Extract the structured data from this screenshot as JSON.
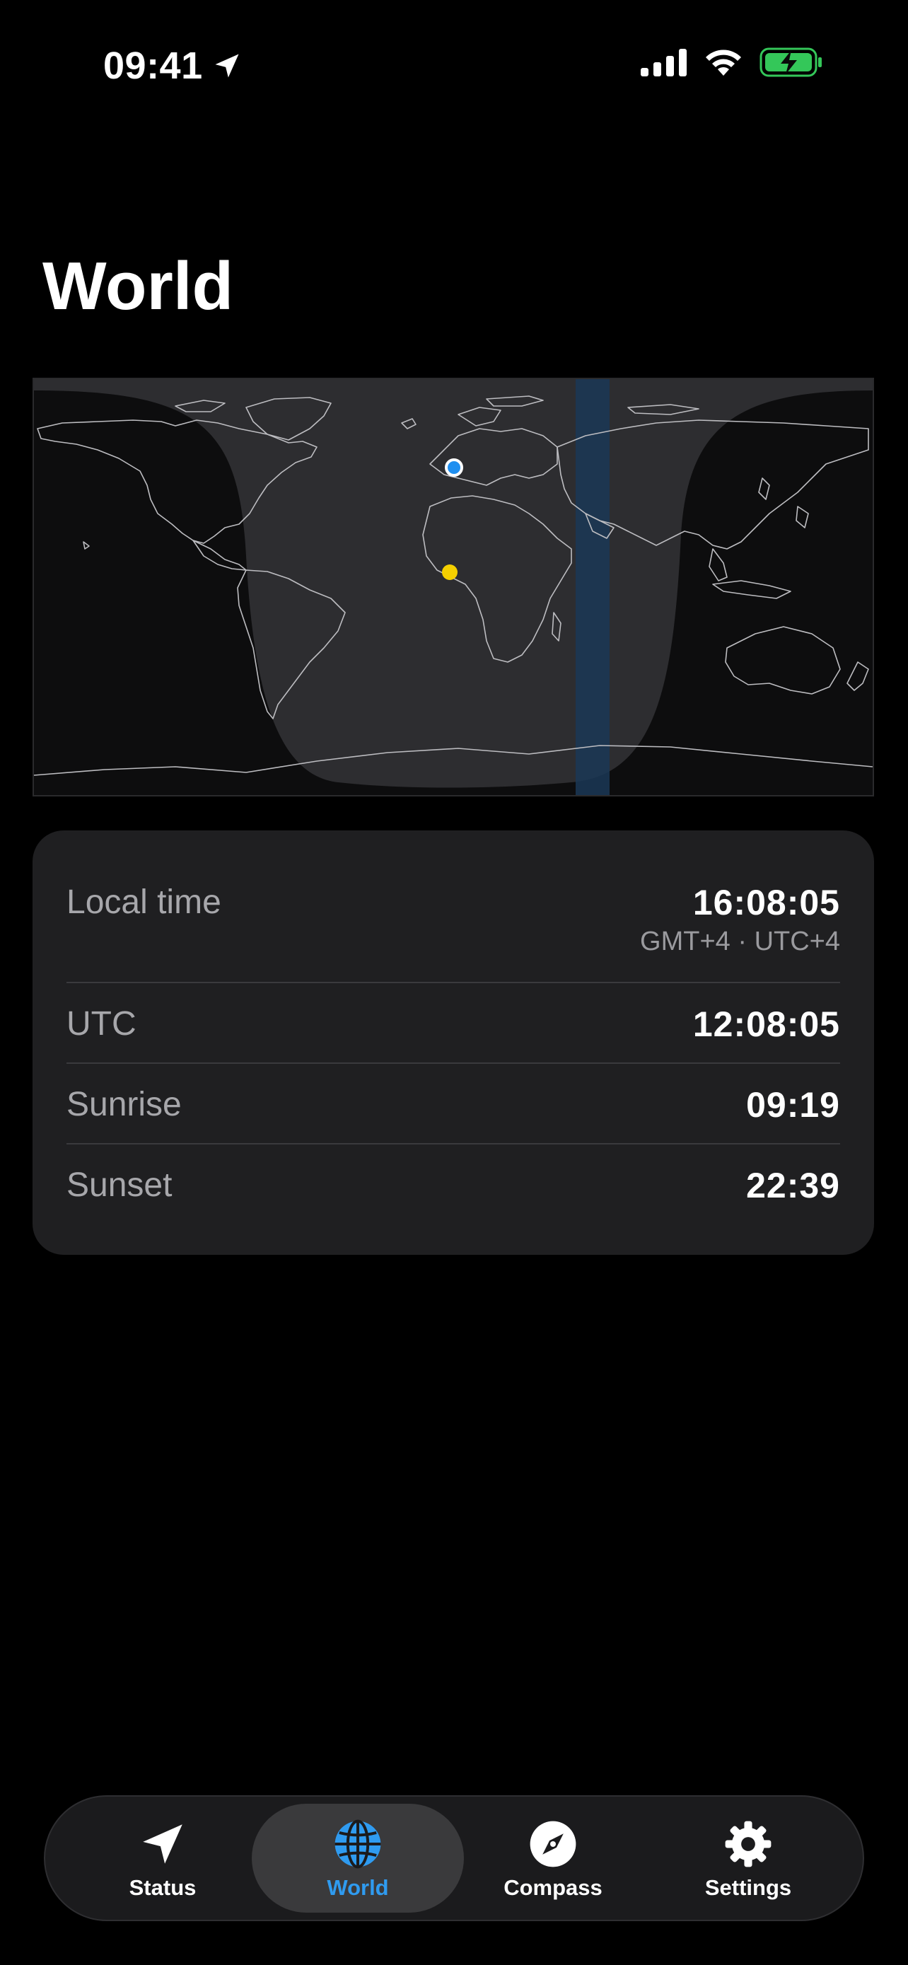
{
  "status_bar": {
    "time": "09:41"
  },
  "title": "World",
  "info": {
    "local_time_label": "Local time",
    "local_time_value": "16:08:05",
    "local_time_zone": "GMT+4 · UTC+4",
    "utc_label": "UTC",
    "utc_value": "12:08:05",
    "sunrise_label": "Sunrise",
    "sunrise_value": "09:19",
    "sunset_label": "Sunset",
    "sunset_value": "22:39"
  },
  "tabs": [
    {
      "label": "Status",
      "icon": "location-arrow-icon",
      "active": false
    },
    {
      "label": "World",
      "icon": "globe-icon",
      "active": true
    },
    {
      "label": "Compass",
      "icon": "compass-icon",
      "active": false
    },
    {
      "label": "Settings",
      "icon": "gear-icon",
      "active": false
    }
  ],
  "colors": {
    "background": "#000000",
    "card": "#1f1f21",
    "accent_blue": "#2f9bf0",
    "sun_marker": "#f5d000",
    "battery_green": "#34c759"
  }
}
